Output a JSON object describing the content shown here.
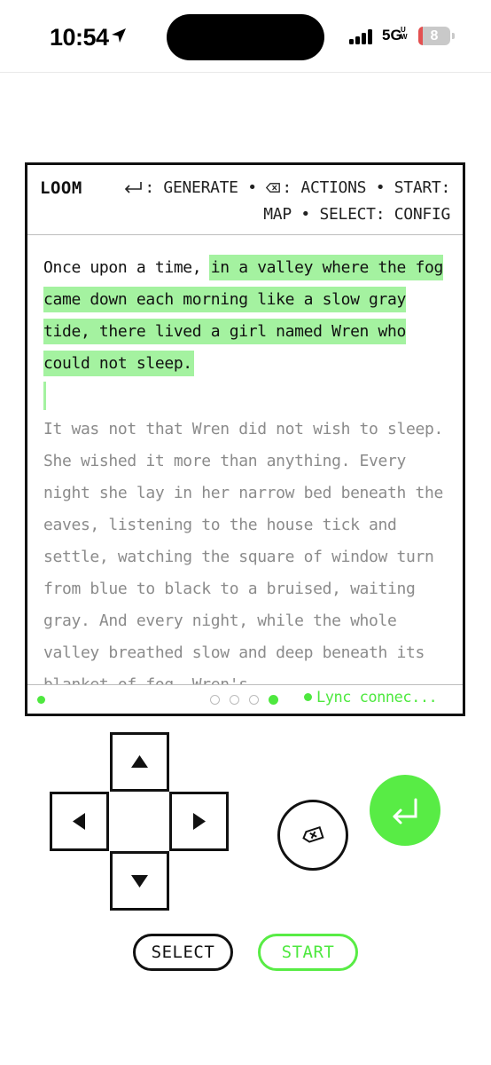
{
  "status_bar": {
    "time": "10:54",
    "network": "5G",
    "network_sup": "UW",
    "battery": "8",
    "icons": [
      "location-arrow-icon",
      "signal-bars-icon",
      "battery-icon"
    ]
  },
  "app": {
    "name": "LOOM",
    "hints_line1": ": GENERATE • ",
    "hints_line1b": ": ACTIONS • START:",
    "hints_line2": "MAP • SELECT: CONFIG"
  },
  "story": {
    "paragraph1_plain": "Once upon a time, ",
    "paragraph1_highlight": "in a valley where the fog came down each morning like a slow gray tide, there lived a girl named Wren who could not sleep.",
    "paragraph2": "It was not that Wren did not wish to sleep. She wished it more than anything. Every night she lay in her narrow bed beneath the eaves, listening to the house tick and settle, watching the square of window turn from blue to black to a bruised, waiting gray. And every night, while the whole valley breathed slow and deep beneath its blanket of fog, Wren's"
  },
  "footer": {
    "page_count": 4,
    "current_page": 4,
    "status": "Lync connec..."
  },
  "controls": {
    "select_label": "SELECT",
    "start_label": "START"
  },
  "colors": {
    "accent": "#58ec45",
    "highlight": "#a4f2a0",
    "text": "#111111",
    "muted_text": "#8b8b8b"
  }
}
